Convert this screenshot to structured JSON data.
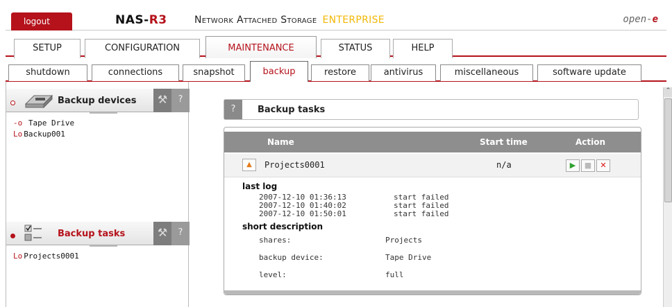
{
  "header": {
    "logout": "logout",
    "brand_prefix": "NAS-",
    "brand_suffix": "R3",
    "subtitle": "Network Attached Storage",
    "edition": "ENTERPRISE",
    "logo_text": "open-",
    "logo_accent": "e"
  },
  "main_tabs": [
    "SETUP",
    "CONFIGURATION",
    "MAINTENANCE",
    "STATUS",
    "HELP"
  ],
  "sub_tabs": [
    "shutdown",
    "connections",
    "snapshot",
    "backup",
    "restore",
    "antivirus",
    "miscellaneous",
    "software update"
  ],
  "sidebar": {
    "devices_title": "Backup devices",
    "devices": [
      "Tape Drive",
      "Backup001"
    ],
    "tasks_title": "Backup tasks",
    "tasks": [
      "Projects0001"
    ],
    "help": "?"
  },
  "content": {
    "header_title": "Backup tasks",
    "help": "?",
    "columns": {
      "name": "Name",
      "start": "Start time",
      "action": "Action"
    },
    "task": {
      "name": "Projects0001",
      "start": "n/a"
    },
    "last_log_label": "last log",
    "logs": [
      {
        "time": "2007-12-10 01:36:13",
        "status": "start failed"
      },
      {
        "time": "2007-12-10 01:40:02",
        "status": "start failed"
      },
      {
        "time": "2007-12-10 01:50:01",
        "status": "start failed"
      }
    ],
    "short_desc_label": "short description",
    "desc": {
      "shares_label": "shares:",
      "shares": "Projects",
      "device_label": "backup device:",
      "device": "Tape Drive",
      "level_label": "level:",
      "level": "full"
    }
  },
  "colors": {
    "brand_red": "#b5121b",
    "accent_yellow": "#f2b705",
    "header_gray": "#8e8e8e"
  }
}
